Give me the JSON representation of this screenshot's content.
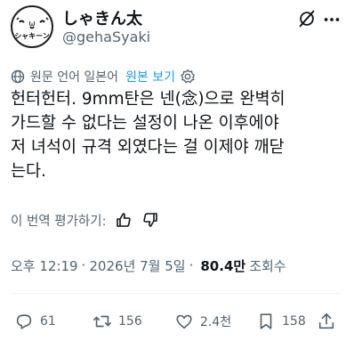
{
  "author": {
    "display_name": "しゃきん太",
    "handle": "@gehaSyaki",
    "avatar_caption": "シャキーン"
  },
  "translation": {
    "note": "원문 언어 일본어",
    "show_original_label": "원본 보기"
  },
  "tweet": {
    "lines": [
      "헌터헌터. 9mm탄은 넨(念)으로 완벽히",
      "가드할 수 없다는 설정이 나온 이후에야",
      "저 녀석이 규격 외였다는 걸 이제야 깨닫",
      "는다."
    ]
  },
  "rate_translation_label": "이 번역 평가하기:",
  "meta": {
    "time": "오후 12:19",
    "separator": "·",
    "date": "2026년 7월 5일",
    "views_count": "80.4만",
    "views_label": "조회수"
  },
  "actions": {
    "reply_count": "61",
    "retweet_count": "156",
    "like_count": "2.4천",
    "bookmark_count": "158"
  },
  "colors": {
    "text": "#0f1419",
    "secondary": "#536471",
    "accent": "#1d9bf0"
  },
  "icons": [
    "grok-icon",
    "more-icon",
    "globe-icon",
    "settings-icon",
    "thumb-up-icon",
    "reply-icon",
    "retweet-icon",
    "like-icon",
    "bookmark-icon",
    "share-icon"
  ]
}
